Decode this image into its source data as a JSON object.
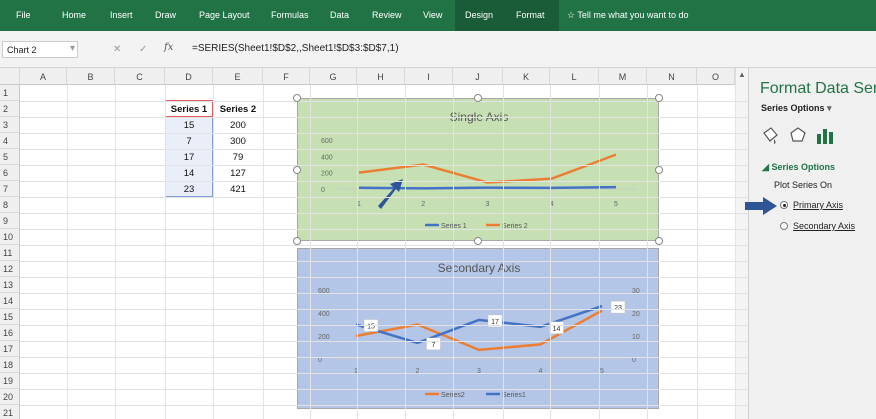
{
  "ribbon": {
    "tabs": [
      "File",
      "Home",
      "Insert",
      "Draw",
      "Page Layout",
      "Formulas",
      "Data",
      "Review",
      "View",
      "Design",
      "Format"
    ],
    "tell_me": "Tell me what you want to do"
  },
  "formula_bar": {
    "name_box": "Chart 2",
    "cancel": "✕",
    "enter": "✓",
    "fx": "fx",
    "formula": "=SERIES(Sheet1!$D$2,,Sheet1!$D$3:$D$7,1)"
  },
  "sheet": {
    "columns": [
      "A",
      "B",
      "C",
      "D",
      "E",
      "F",
      "G",
      "H",
      "I",
      "J",
      "K",
      "L",
      "M",
      "N",
      "O"
    ],
    "rows": [
      "1",
      "2",
      "3",
      "4",
      "5",
      "6",
      "7",
      "8",
      "9",
      "10",
      "11",
      "12",
      "13",
      "14",
      "15",
      "16",
      "17",
      "18",
      "19",
      "20",
      "21"
    ],
    "table": {
      "headers": [
        "Series 1",
        "Series 2"
      ],
      "rows": [
        [
          "15",
          "200"
        ],
        [
          "7",
          "300"
        ],
        [
          "17",
          "79"
        ],
        [
          "14",
          "127"
        ],
        [
          "23",
          "421"
        ]
      ]
    }
  },
  "chart_data": [
    {
      "type": "line",
      "title": "Single Axis",
      "categories": [
        "1",
        "2",
        "3",
        "4",
        "5"
      ],
      "yticks": [
        "600",
        "400",
        "200",
        "0"
      ],
      "ylim": [
        0,
        600
      ],
      "series": [
        {
          "name": "Series 1",
          "values": [
            15,
            7,
            17,
            14,
            23
          ],
          "color": "#4472c4"
        },
        {
          "name": "Series 2",
          "values": [
            200,
            300,
            79,
            127,
            421
          ],
          "color": "#ed7d31"
        }
      ],
      "legend": "bottom",
      "grid": false
    },
    {
      "type": "line",
      "title": "Secondary Axis",
      "categories": [
        "1",
        "2",
        "3",
        "4",
        "5"
      ],
      "yticks": [
        "600",
        "400",
        "200",
        "0"
      ],
      "ylim": [
        0,
        600
      ],
      "y2ticks": [
        "30",
        "20",
        "10",
        "0"
      ],
      "y2lim": [
        0,
        30
      ],
      "series": [
        {
          "name": "Series2",
          "values": [
            200,
            300,
            79,
            127,
            421
          ],
          "color": "#ed7d31",
          "axis": "primary"
        },
        {
          "name": "Series1",
          "values": [
            15,
            7,
            17,
            14,
            23
          ],
          "color": "#4472c4",
          "axis": "secondary",
          "data_labels": [
            "15",
            "7",
            "17",
            "14",
            "23"
          ]
        }
      ],
      "legend": "bottom",
      "grid": false
    }
  ],
  "panel": {
    "title": "Format Data Seri",
    "series_options_menu": "Series Options",
    "section": "Series Options",
    "plot_on": "Plot Series On",
    "primary": "Primary Axis",
    "secondary": "Secondary Axis",
    "selected": "primary"
  },
  "colors": {
    "ribbon": "#217346",
    "chart1_bg": "#c6e0b4",
    "chart2_bg": "#b4c6e7",
    "series1": "#4472c4",
    "series2": "#ed7d31",
    "arrow": "#2f5597"
  }
}
